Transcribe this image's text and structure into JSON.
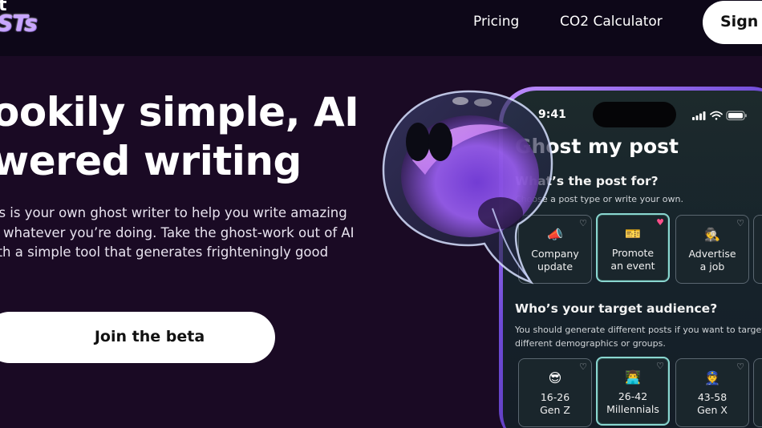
{
  "header": {
    "logo_line1": "t",
    "logo_line2": "STs",
    "nav": {
      "pricing": "Pricing",
      "co2": "CO2 Calculator"
    },
    "signin": "Sign In"
  },
  "hero": {
    "title_lines": [
      "ookily simple, AI",
      "wered writing"
    ],
    "desc_lines": [
      "ts is your own ghost writer to help you write amazing",
      "r whatever you’re doing. Take the ghost-work out of AI",
      "ith a simple tool that generates frighteningly good"
    ],
    "cta": "Join the beta"
  },
  "phone": {
    "time": "9:41",
    "title": "Ghost my post",
    "section1": {
      "title": "What’s the post for?",
      "subtitle": "Choose a post type or write your own.",
      "cards": [
        {
          "emoji": "📣",
          "line1": "Company",
          "line2": "update",
          "favorite": false,
          "selected": false
        },
        {
          "emoji": "🎫",
          "line1": "Promote",
          "line2": "an event",
          "favorite": true,
          "selected": true
        },
        {
          "emoji": "🕵️",
          "line1": "Advertise",
          "line2": "a job",
          "favorite": false,
          "selected": false
        }
      ]
    },
    "section2": {
      "title": "Who’s your target audience?",
      "subtitle": "You should generate different posts if you want to target different demographics or groups.",
      "cards": [
        {
          "emoji": "😎",
          "line1": "16-26",
          "line2": "Gen Z",
          "favorite": false,
          "selected": false
        },
        {
          "emoji": "👨‍💻",
          "line1": "26-42",
          "line2": "Millennials",
          "favorite": false,
          "selected": true
        },
        {
          "emoji": "👮",
          "line1": "43-58",
          "line2": "Gen X",
          "favorite": false,
          "selected": false
        }
      ]
    }
  },
  "colors": {
    "background": "#1a0a24",
    "header": "#0d0718",
    "accent_teal": "#89d6d0",
    "heart_on": "#ff4f8a"
  }
}
